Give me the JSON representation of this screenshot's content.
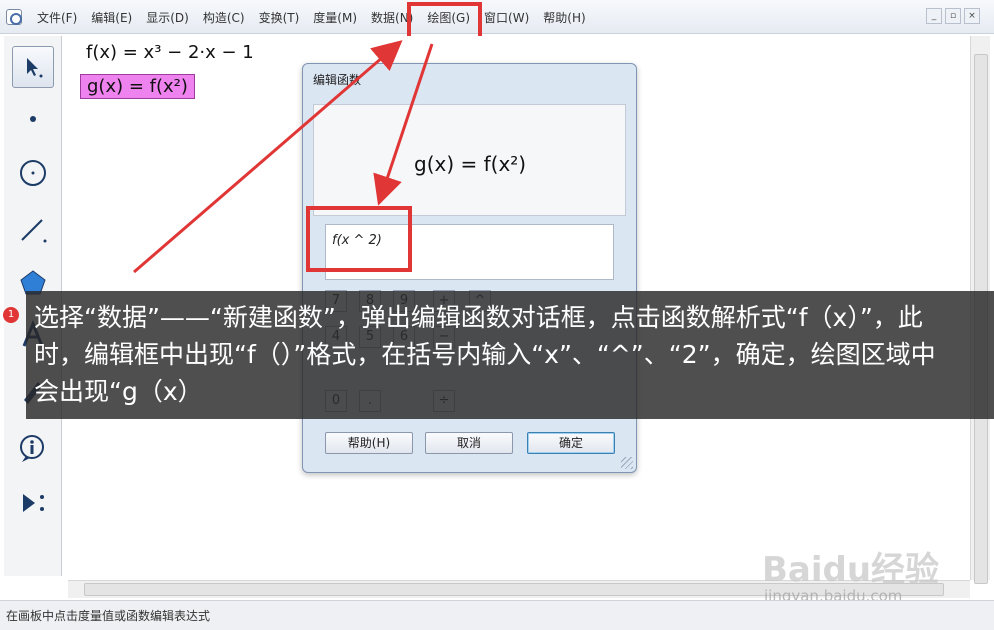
{
  "menubar": {
    "items": [
      "文件(F)",
      "编辑(E)",
      "显示(D)",
      "构造(C)",
      "变换(T)",
      "度量(M)",
      "数据(N)",
      "绘图(G)",
      "窗口(W)",
      "帮助(H)"
    ],
    "window_buttons": [
      "_",
      "▫",
      "×"
    ]
  },
  "canvas": {
    "expr_f": "f(x) = x³ − 2·x − 1",
    "expr_g": "g(x) = f(x²)"
  },
  "dialog": {
    "title": "编辑函数",
    "preview": "g(x) = f(x²)",
    "input_value": "f(x ^ 2)",
    "keys": [
      "7",
      "8",
      "9",
      "+",
      "^",
      "4",
      "5",
      "6",
      "−",
      "0",
      ".",
      "÷"
    ],
    "buttons": {
      "help": "帮助(H)",
      "cancel": "取消",
      "ok": "确定"
    }
  },
  "caption": {
    "badge": "1",
    "text": "选择“数据”——“新建函数”，弹出编辑函数对话框，点击函数解析式“f（x）”，此时，编辑框中出现“f（）”格式，在括号内输入“x”、“^”、“2”，确定，绘图区域中会出现“g（x）"
  },
  "status": {
    "text": "在画板中点击度量值或函数编辑表达式"
  },
  "watermark": {
    "brand": "Baidu经验",
    "url": "jingyan.baidu.com"
  },
  "colors": {
    "highlight": "#e03636",
    "selected_expr": "#ee82ee",
    "caption_bg": "#282828"
  }
}
